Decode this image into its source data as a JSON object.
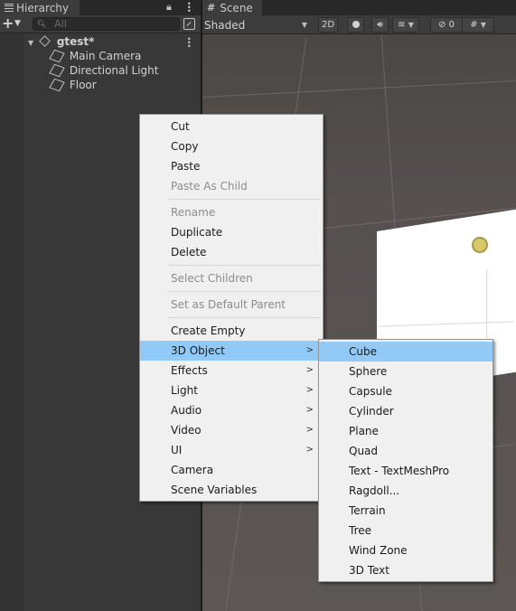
{
  "hierarchy": {
    "tab_label": "Hierarchy",
    "search_placeholder": "All",
    "scene_name": "gtest*",
    "objects": [
      "Main Camera",
      "Directional Light",
      "Floor"
    ]
  },
  "scene_panel": {
    "tab_label": "Scene",
    "shading_mode": "Shaded",
    "btn_2d": "2D",
    "hidden_count": "0"
  },
  "context_menu": {
    "items": [
      {
        "label": "Cut",
        "enabled": true
      },
      {
        "label": "Copy",
        "enabled": true
      },
      {
        "label": "Paste",
        "enabled": true
      },
      {
        "label": "Paste As Child",
        "enabled": false
      },
      {
        "label": "Rename",
        "enabled": false
      },
      {
        "label": "Duplicate",
        "enabled": true
      },
      {
        "label": "Delete",
        "enabled": true
      },
      {
        "label": "Select Children",
        "enabled": false
      },
      {
        "label": "Set as Default Parent",
        "enabled": false
      },
      {
        "label": "Create Empty",
        "enabled": true
      },
      {
        "label": "3D Object",
        "enabled": true,
        "submenu": true,
        "highlighted": true
      },
      {
        "label": "Effects",
        "enabled": true,
        "submenu": true
      },
      {
        "label": "Light",
        "enabled": true,
        "submenu": true
      },
      {
        "label": "Audio",
        "enabled": true,
        "submenu": true
      },
      {
        "label": "Video",
        "enabled": true,
        "submenu": true
      },
      {
        "label": "UI",
        "enabled": true,
        "submenu": true
      },
      {
        "label": "Camera",
        "enabled": true
      },
      {
        "label": "Scene Variables",
        "enabled": true
      }
    ]
  },
  "submenu_3d_object": {
    "items": [
      {
        "label": "Cube",
        "highlighted": true
      },
      {
        "label": "Sphere"
      },
      {
        "label": "Capsule"
      },
      {
        "label": "Cylinder"
      },
      {
        "label": "Plane"
      },
      {
        "label": "Quad"
      },
      {
        "label": "Text - TextMeshPro"
      },
      {
        "label": "Ragdoll..."
      },
      {
        "label": "Terrain"
      },
      {
        "label": "Tree"
      },
      {
        "label": "Wind Zone"
      },
      {
        "label": "3D Text"
      }
    ]
  },
  "icons": {
    "hierarchy_tab": "list-icon",
    "scene_tab": "hash-icon",
    "lock": "lock-icon",
    "menu": "kebab-menu-icon",
    "add": "plus-icon",
    "search": "search-icon",
    "scene_asset": "unity-logo-icon",
    "game_object": "cube-icon",
    "light_gizmo": "sun-icon",
    "submenu_arrow": "chevron-right-icon"
  },
  "colors": {
    "menu_highlight": "#91c9f7",
    "menu_background": "#f0f0f0",
    "panel_background": "#383838",
    "disabled_text": "#8c8c8c"
  }
}
